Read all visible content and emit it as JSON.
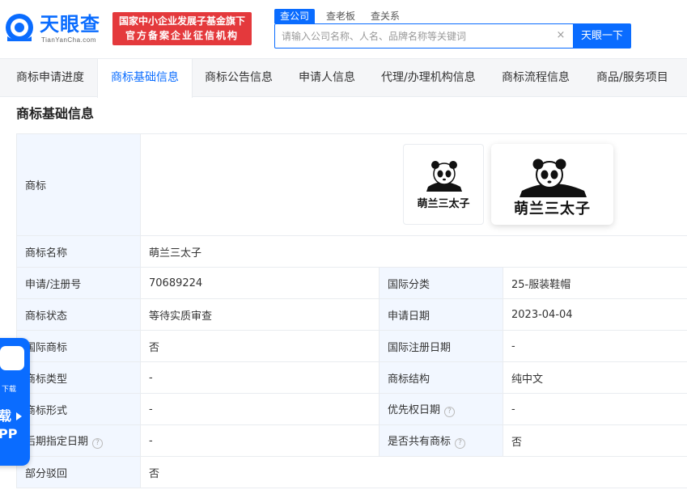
{
  "header": {
    "logo_name": "天眼查",
    "logo_sub": "TianYanCha.com",
    "badge_line1": "国家中小企业发展子基金旗下",
    "badge_line2": "官方备案企业征信机构",
    "search_tabs": [
      "查公司",
      "查老板",
      "查关系"
    ],
    "search_placeholder": "请输入公司名称、人名、品牌名称等关键词",
    "clear_icon": "×",
    "search_button": "天眼一下"
  },
  "tabs": [
    "商标申请进度",
    "商标基础信息",
    "商标公告信息",
    "申请人信息",
    "代理/办理机构信息",
    "商标流程信息",
    "商品/服务项目"
  ],
  "section_title": "商标基础信息",
  "trademark_text": "萌兰三太子",
  "rows": {
    "logo_label": "商标",
    "name_label": "商标名称",
    "name_value": "萌兰三太子",
    "reg_label": "申请/注册号",
    "reg_value": "70689224",
    "intl_class_label": "国际分类",
    "intl_class_value": "25-服装鞋帽",
    "status_label": "商标状态",
    "status_value": "等待实质审查",
    "apply_date_label": "申请日期",
    "apply_date_value": "2023-04-04",
    "intl_tm_label": "国际商标",
    "intl_tm_value": "否",
    "intl_reg_date_label": "国际注册日期",
    "intl_reg_date_value": "-",
    "type_label": "商标类型",
    "type_value": "-",
    "structure_label": "商标结构",
    "structure_value": "纯中文",
    "form_label": "商标形式",
    "form_value": "-",
    "priority_label": "优先权日期",
    "priority_value": "-",
    "later_date_label": "后期指定日期",
    "later_date_value": "-",
    "shared_label": "是否共有商标",
    "shared_value": "否",
    "partial_label": "部分驳回",
    "partial_value": "否"
  },
  "help_glyph": "?",
  "app_float": {
    "download_text": "下载",
    "app_text": "载\nPP"
  },
  "colors": {
    "accent": "#0a6cff",
    "badge_red": "#e4393c",
    "label_bg": "#f2f7ff",
    "tabbar_bg": "#f5f6f8"
  },
  "icons": [
    "tianyancha-logo-icon",
    "clear-icon",
    "question-circle-icon",
    "panda-logo-icon",
    "app-icon",
    "play-icon"
  ]
}
